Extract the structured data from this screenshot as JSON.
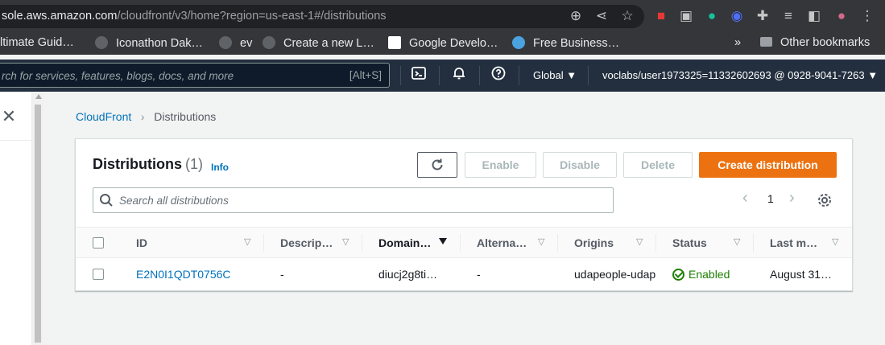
{
  "browser": {
    "url_host": "sole.aws.amazon.com",
    "url_path": "/cloudfront/v3/home?region=us-east-1#/distributions",
    "bookmarks": [
      {
        "label": "ltimate Guid…"
      },
      {
        "label": "Iconathon Dak…"
      },
      {
        "label": "ev"
      },
      {
        "label": "Create a new L…"
      },
      {
        "label": "Google Develo…"
      },
      {
        "label": "Free Business…"
      }
    ],
    "overflow": "»",
    "other_bookmarks": "Other bookmarks"
  },
  "aws_nav": {
    "search_placeholder": "rch for services, features, blogs, docs, and more",
    "search_shortcut": "[Alt+S]",
    "region": "Global",
    "account": "voclabs/user1973325=11332602693 @ 0928-9041-7263"
  },
  "breadcrumb": {
    "root": "CloudFront",
    "current": "Distributions"
  },
  "distributions": {
    "title": "Distributions",
    "count": "(1)",
    "info": "Info",
    "actions": {
      "enable": "Enable",
      "disable": "Disable",
      "delete": "Delete",
      "create": "Create distribution"
    },
    "search_placeholder": "Search all distributions",
    "page": "1",
    "columns": [
      {
        "label": "ID"
      },
      {
        "label": "Descrip…"
      },
      {
        "label": "Domain…"
      },
      {
        "label": "Alterna…"
      },
      {
        "label": "Origins"
      },
      {
        "label": "Status"
      },
      {
        "label": "Last m…"
      }
    ],
    "rows": [
      {
        "id": "E2N0I1QDT0756C",
        "description": "-",
        "domain": "diucj2g8ti…",
        "alternate": "-",
        "origins": "udapeople-udap",
        "status": "Enabled",
        "last_modified": "August 31…"
      }
    ]
  },
  "colors": {
    "primary_button": "#ec7211",
    "link": "#0073bb",
    "aws_nav_bg": "#232f3e",
    "status_enabled": "#1d8102"
  }
}
